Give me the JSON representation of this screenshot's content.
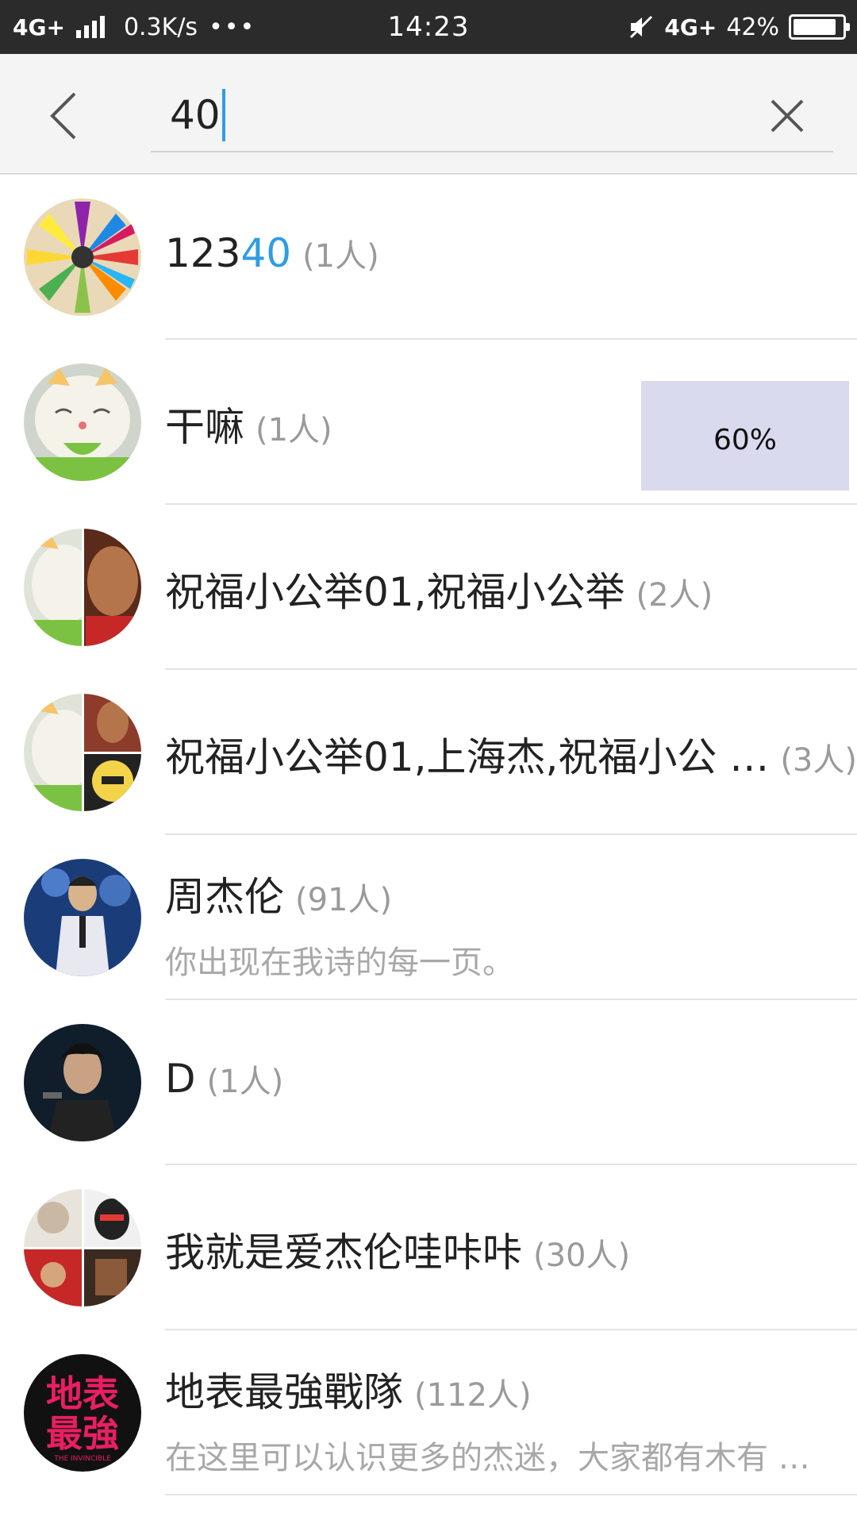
{
  "status_bar": {
    "network_left": "4G+",
    "speed": "0.3K/s",
    "dots": "•••",
    "time": "14:23",
    "network_right": "4G+",
    "battery_percent": "42%",
    "battery_level": 0.88
  },
  "search": {
    "query": "40"
  },
  "results": [
    {
      "title_pre": "123",
      "title_hl": "40",
      "count": "(1人)",
      "subtitle": ""
    },
    {
      "title_pre": "干嘛",
      "title_hl": "",
      "count": "(1人)",
      "subtitle": ""
    },
    {
      "title_pre": "祝福小公举01,祝福小公举",
      "title_hl": "",
      "count": "(2人)",
      "subtitle": ""
    },
    {
      "title_pre": "祝福小公举01,上海杰,祝福小公 …",
      "title_hl": "",
      "count": "(3人)",
      "subtitle": ""
    },
    {
      "title_pre": "周杰伦",
      "title_hl": "",
      "count": "(91人)",
      "subtitle": "你出现在我诗的每一页。"
    },
    {
      "title_pre": "D",
      "title_hl": "",
      "count": "(1人)",
      "subtitle": ""
    },
    {
      "title_pre": "我就是爱杰伦哇咔咔",
      "title_hl": "",
      "count": "(30人)",
      "subtitle": ""
    },
    {
      "title_pre": "地表最強戰隊",
      "title_hl": "",
      "count": "(112人)",
      "subtitle": "在这里可以认识更多的杰迷，大家都有木有 …"
    }
  ],
  "avatar_8_text": {
    "line1": "地表",
    "line2": "最強",
    "line3": "THE INVINCIBLE"
  },
  "overlay": {
    "progress": "60%"
  },
  "colors": {
    "accent": "#2f9de2",
    "status_bar": "#2b2b2b",
    "header_bg": "#f4f4f4"
  }
}
